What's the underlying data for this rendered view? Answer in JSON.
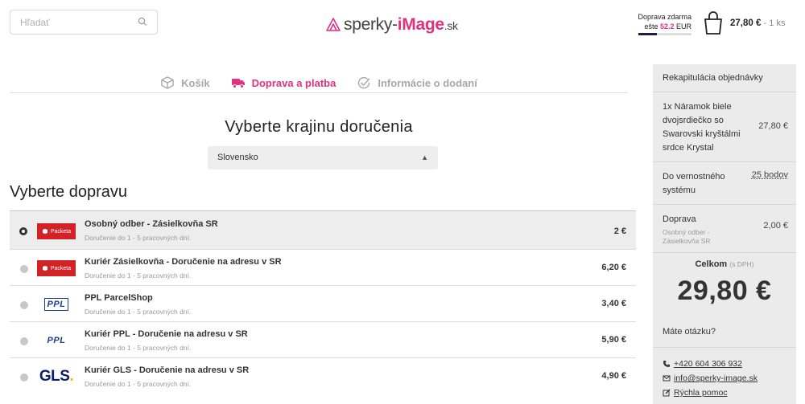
{
  "header": {
    "search_placeholder": "Hľadať",
    "logo_text_a": "sperky-",
    "logo_text_b": "iMage",
    "logo_text_c": ".sk",
    "free_shipping_line1": "Doprava zdarma",
    "free_shipping_prefix": "ešte ",
    "free_shipping_amount": "52.2",
    "free_shipping_suffix": " EUR",
    "free_shipping_progress": 0.35,
    "cart_price": "27,80 €",
    "cart_qty": "- 1 ks"
  },
  "steps": [
    {
      "label": "Košík",
      "state": "done"
    },
    {
      "label": "Doprava a platba",
      "state": "active"
    },
    {
      "label": "Informácie o dodaní",
      "state": "todo"
    }
  ],
  "country": {
    "title": "Vyberte krajinu doručenia",
    "selected": "Slovensko"
  },
  "shipping": {
    "title": "Vyberte dopravu",
    "options": [
      {
        "name": "Osobný odber - Zásielkovňa SR",
        "desc": "Doručenie do 1 - 5 pracovných dní.",
        "price": "2 €",
        "carrier": "Packeta",
        "selected": true
      },
      {
        "name": "Kuriér Zásielkovňa - Doručenie na adresu v SR",
        "desc": "Doručenie do 1 - 5 pracovných dní.",
        "price": "6,20 €",
        "carrier": "Packeta",
        "selected": false
      },
      {
        "name": "PPL ParcelShop",
        "desc": "Doručenie do 1 - 5 pracovných dní.",
        "price": "3,40 €",
        "carrier": "PPL",
        "selected": false
      },
      {
        "name": "Kuriér PPL - Doručenie na adresu v SR",
        "desc": "Doručenie do 1 - 5 pracovných dní.",
        "price": "5,90 €",
        "carrier": "PPL",
        "selected": false
      },
      {
        "name": "Kuriér GLS - Doručenie na adresu v SR",
        "desc": "Doručenie do 1 - 5 pracovných dní.",
        "price": "4,90 €",
        "carrier": "GLS",
        "selected": false
      }
    ]
  },
  "summary": {
    "title": "Rekapitulácia objednávky",
    "product": "1x Náramok biele dvojsrdiečko so Swarovski kryštálmi srdce Krystal",
    "product_price": "27,80 €",
    "loyalty_label": "Do vernostného systému",
    "loyalty_value": "25 bodov",
    "shipping_label": "Doprava",
    "shipping_sub": "Osobný odber - Zásielkovňa SR",
    "shipping_price": "2,00 €",
    "total_label": "Celkom",
    "total_vat": "(s DPH)",
    "total": "29,80 €"
  },
  "help": {
    "title": "Máte otázku?",
    "phone": "+420 604 306 932",
    "email": "info@sperky-image.sk",
    "quick": "Rýchla pomoc"
  },
  "colors": {
    "accent": "#e0327f",
    "packeta": "#d22226",
    "ppl": "#1d3d8f",
    "gls": "#0e1d6e"
  }
}
